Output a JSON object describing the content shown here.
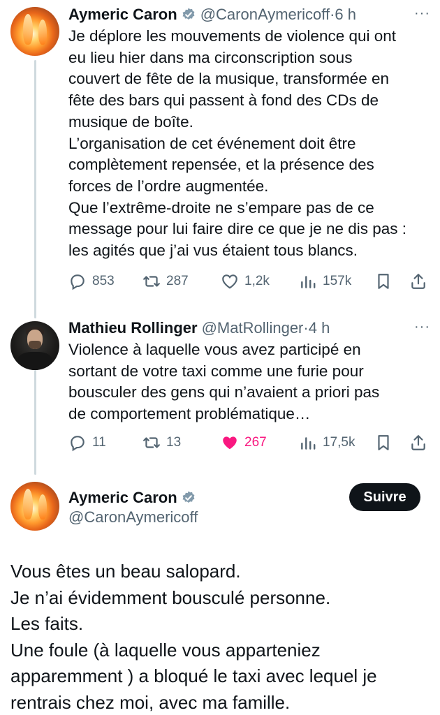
{
  "tweets": [
    {
      "name": "Aymeric Caron",
      "handle": "@CaronAymericoff",
      "dot": "·",
      "time": "6 h",
      "more": "···",
      "text": "Je déplore les mouvements de violence qui ont\neu lieu hier dans ma circonscription sous\ncouvert de fête de la musique, transformée en\nfête des bars qui passent à fond des CDs de\nmusique de boîte.\nL’organisation de cet événement doit être\ncomplètement repensée, et la présence des\nforces de l’ordre augmentée.\nQue l’extrême-droite ne s’empare pas de ce\nmessage pour lui faire dire ce que je ne dis pas :\nles agités que j’ai vus étaient tous blancs.",
      "replies": "853",
      "retweets": "287",
      "likes": "1,2k",
      "views": "157k"
    },
    {
      "name": "Mathieu Rollinger",
      "handle": "@MatRollinger",
      "dot": "·",
      "time": "4 h",
      "more": "···",
      "text": "Violence à laquelle vous avez participé en\nsortant de votre taxi comme une furie pour\nbousculer des gens qui n’avaient a priori pas\nde comportement problématique…",
      "replies": "11",
      "retweets": "13",
      "likes": "267",
      "views": "17,5k"
    }
  ],
  "main_tweet": {
    "name": "Aymeric Caron",
    "handle": "@CaronAymericoff",
    "follow_label": "Suivre",
    "text": "Vous êtes un beau salopard.\nJe n’ai évidemment bousculé personne.\nLes faits.\nUne foule (à laquelle vous apparteniez\napparemment ) a bloqué le taxi avec lequel je\nrentrais chez moi, avec ma famille."
  },
  "colors": {
    "text": "#0f1419",
    "secondary": "#536471",
    "verified": "#829aab",
    "like_active": "#f91880",
    "thread_line": "#cfd9de"
  },
  "icons": [
    "reply-icon",
    "retweet-icon",
    "like-icon",
    "views-icon",
    "bookmark-icon",
    "share-icon",
    "verified-badge-icon",
    "more-icon"
  ]
}
